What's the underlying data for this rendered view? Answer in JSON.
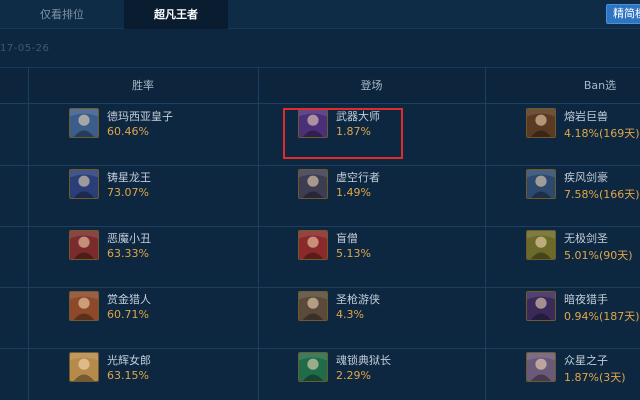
{
  "tabs": [
    {
      "label": "仅看排位",
      "active": false
    },
    {
      "label": "超凡王者",
      "active": true
    }
  ],
  "top_button": {
    "label": "精简模式"
  },
  "date": "17-05-26",
  "columns": [
    "胜率",
    "登场",
    "Ban选"
  ],
  "win_rate": [
    {
      "name": "德玛西亚皇子",
      "value": "60.46%",
      "icon": "champion-portrait-icon"
    },
    {
      "name": "铸星龙王",
      "value": "73.07%",
      "icon": "champion-portrait-icon"
    },
    {
      "name": "恶魔小丑",
      "value": "63.33%",
      "icon": "champion-portrait-icon"
    },
    {
      "name": "赏金猎人",
      "value": "60.71%",
      "icon": "champion-portrait-icon"
    },
    {
      "name": "光辉女郎",
      "value": "63.15%",
      "icon": "champion-portrait-icon"
    }
  ],
  "pick_rate": [
    {
      "name": "武器大师",
      "value": "1.87%",
      "icon": "champion-portrait-icon",
      "highlighted": true
    },
    {
      "name": "虚空行者",
      "value": "1.49%",
      "icon": "champion-portrait-icon"
    },
    {
      "name": "盲僧",
      "value": "5.13%",
      "icon": "champion-portrait-icon"
    },
    {
      "name": "圣枪游侠",
      "value": "4.3%",
      "icon": "champion-portrait-icon"
    },
    {
      "name": "魂锁典狱长",
      "value": "2.29%",
      "icon": "champion-portrait-icon"
    }
  ],
  "ban_rate": [
    {
      "name": "熔岩巨兽",
      "value": "4.18%(169天)",
      "icon": "champion-portrait-icon"
    },
    {
      "name": "疾风剑豪",
      "value": "7.58%(166天)",
      "icon": "champion-portrait-icon"
    },
    {
      "name": "无极剑圣",
      "value": "5.01%(90天)",
      "icon": "champion-portrait-icon"
    },
    {
      "name": "暗夜猎手",
      "value": "0.94%(187天)",
      "icon": "champion-portrait-icon"
    },
    {
      "name": "众星之子",
      "value": "1.87%(3天)",
      "icon": "champion-portrait-icon"
    }
  ],
  "colors": {
    "background": "#0d2740",
    "value_text": "#e0a64a",
    "ban_text": "#43c47a",
    "highlight_box": "#e02b2b",
    "button": "#2d74c2"
  }
}
